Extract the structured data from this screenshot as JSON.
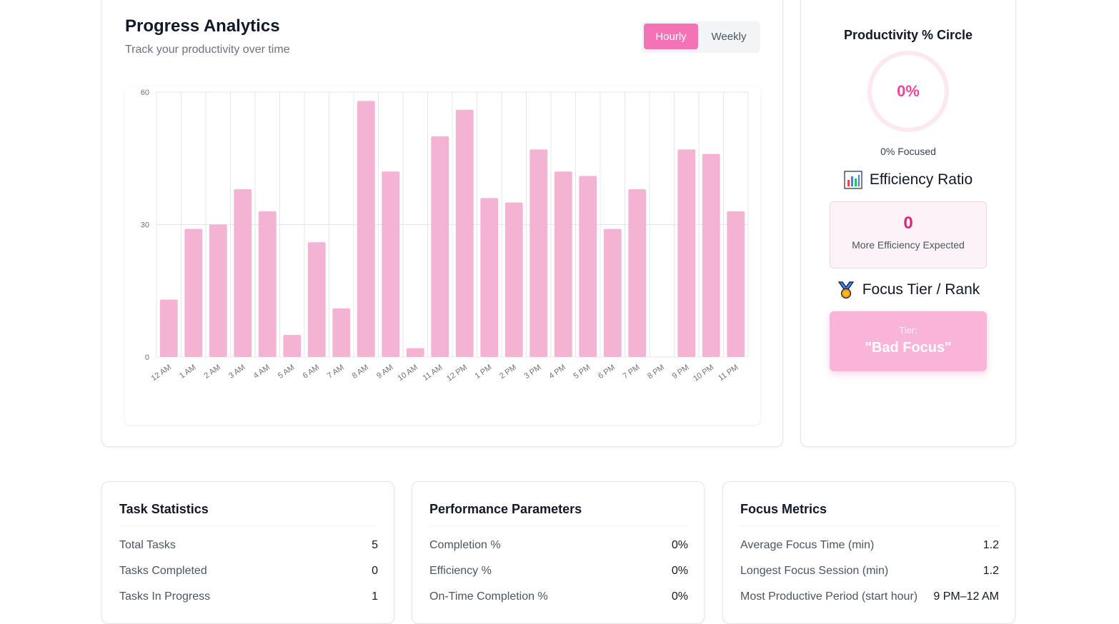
{
  "analytics": {
    "title": "Progress Analytics",
    "subtitle": "Track your productivity over time",
    "toggle": {
      "hourly": "Hourly",
      "weekly": "Weekly",
      "active": "hourly"
    }
  },
  "chart_data": {
    "type": "bar",
    "categories": [
      "12 AM",
      "1 AM",
      "2 AM",
      "3 AM",
      "4 AM",
      "5 AM",
      "6 AM",
      "7 AM",
      "8 AM",
      "9 AM",
      "10 AM",
      "11 AM",
      "12 PM",
      "1 PM",
      "2 PM",
      "3 PM",
      "4 PM",
      "5 PM",
      "6 PM",
      "7 PM",
      "8 PM",
      "9 PM",
      "10 PM",
      "11 PM"
    ],
    "values": [
      13,
      29,
      30,
      38,
      33,
      5,
      26,
      11,
      58,
      42,
      2,
      50,
      56,
      36,
      35,
      47,
      42,
      41,
      29,
      38,
      0,
      47,
      46,
      33
    ],
    "ylim": [
      0,
      60
    ],
    "yticks": [
      0,
      30,
      60
    ],
    "bar_color": "#f4b3d3",
    "grid": true
  },
  "side": {
    "circle_title": "Productivity % Circle",
    "circle_value": "0%",
    "focused_text": "0% Focused",
    "efficiency_title": "Efficiency Ratio",
    "efficiency_icon": "bar-chart-icon",
    "efficiency_value": "0",
    "efficiency_note": "More Efficiency Expected",
    "tier_title": "Focus Tier / Rank",
    "tier_icon": "medal-icon",
    "tier_label": "Tier:",
    "tier_value": "\"Bad Focus\""
  },
  "task_stats": {
    "title": "Task Statistics",
    "rows": [
      {
        "label": "Total Tasks",
        "value": "5"
      },
      {
        "label": "Tasks Completed",
        "value": "0"
      },
      {
        "label": "Tasks In Progress",
        "value": "1"
      }
    ]
  },
  "performance": {
    "title": "Performance Parameters",
    "rows": [
      {
        "label": "Completion %",
        "value": "0%"
      },
      {
        "label": "Efficiency %",
        "value": "0%"
      },
      {
        "label": "On-Time Completion %",
        "value": "0%"
      }
    ]
  },
  "focus_metrics": {
    "title": "Focus Metrics",
    "rows": [
      {
        "label": "Average Focus Time (min)",
        "value": "1.2"
      },
      {
        "label": "Longest Focus Session (min)",
        "value": "1.2"
      },
      {
        "label": "Most Productive Period (start hour)",
        "value": "9 PM–12 AM"
      }
    ]
  },
  "colors": {
    "accent": "#f472b6",
    "accent_dark": "#db2777",
    "pink_light": "#fdf2f8"
  }
}
